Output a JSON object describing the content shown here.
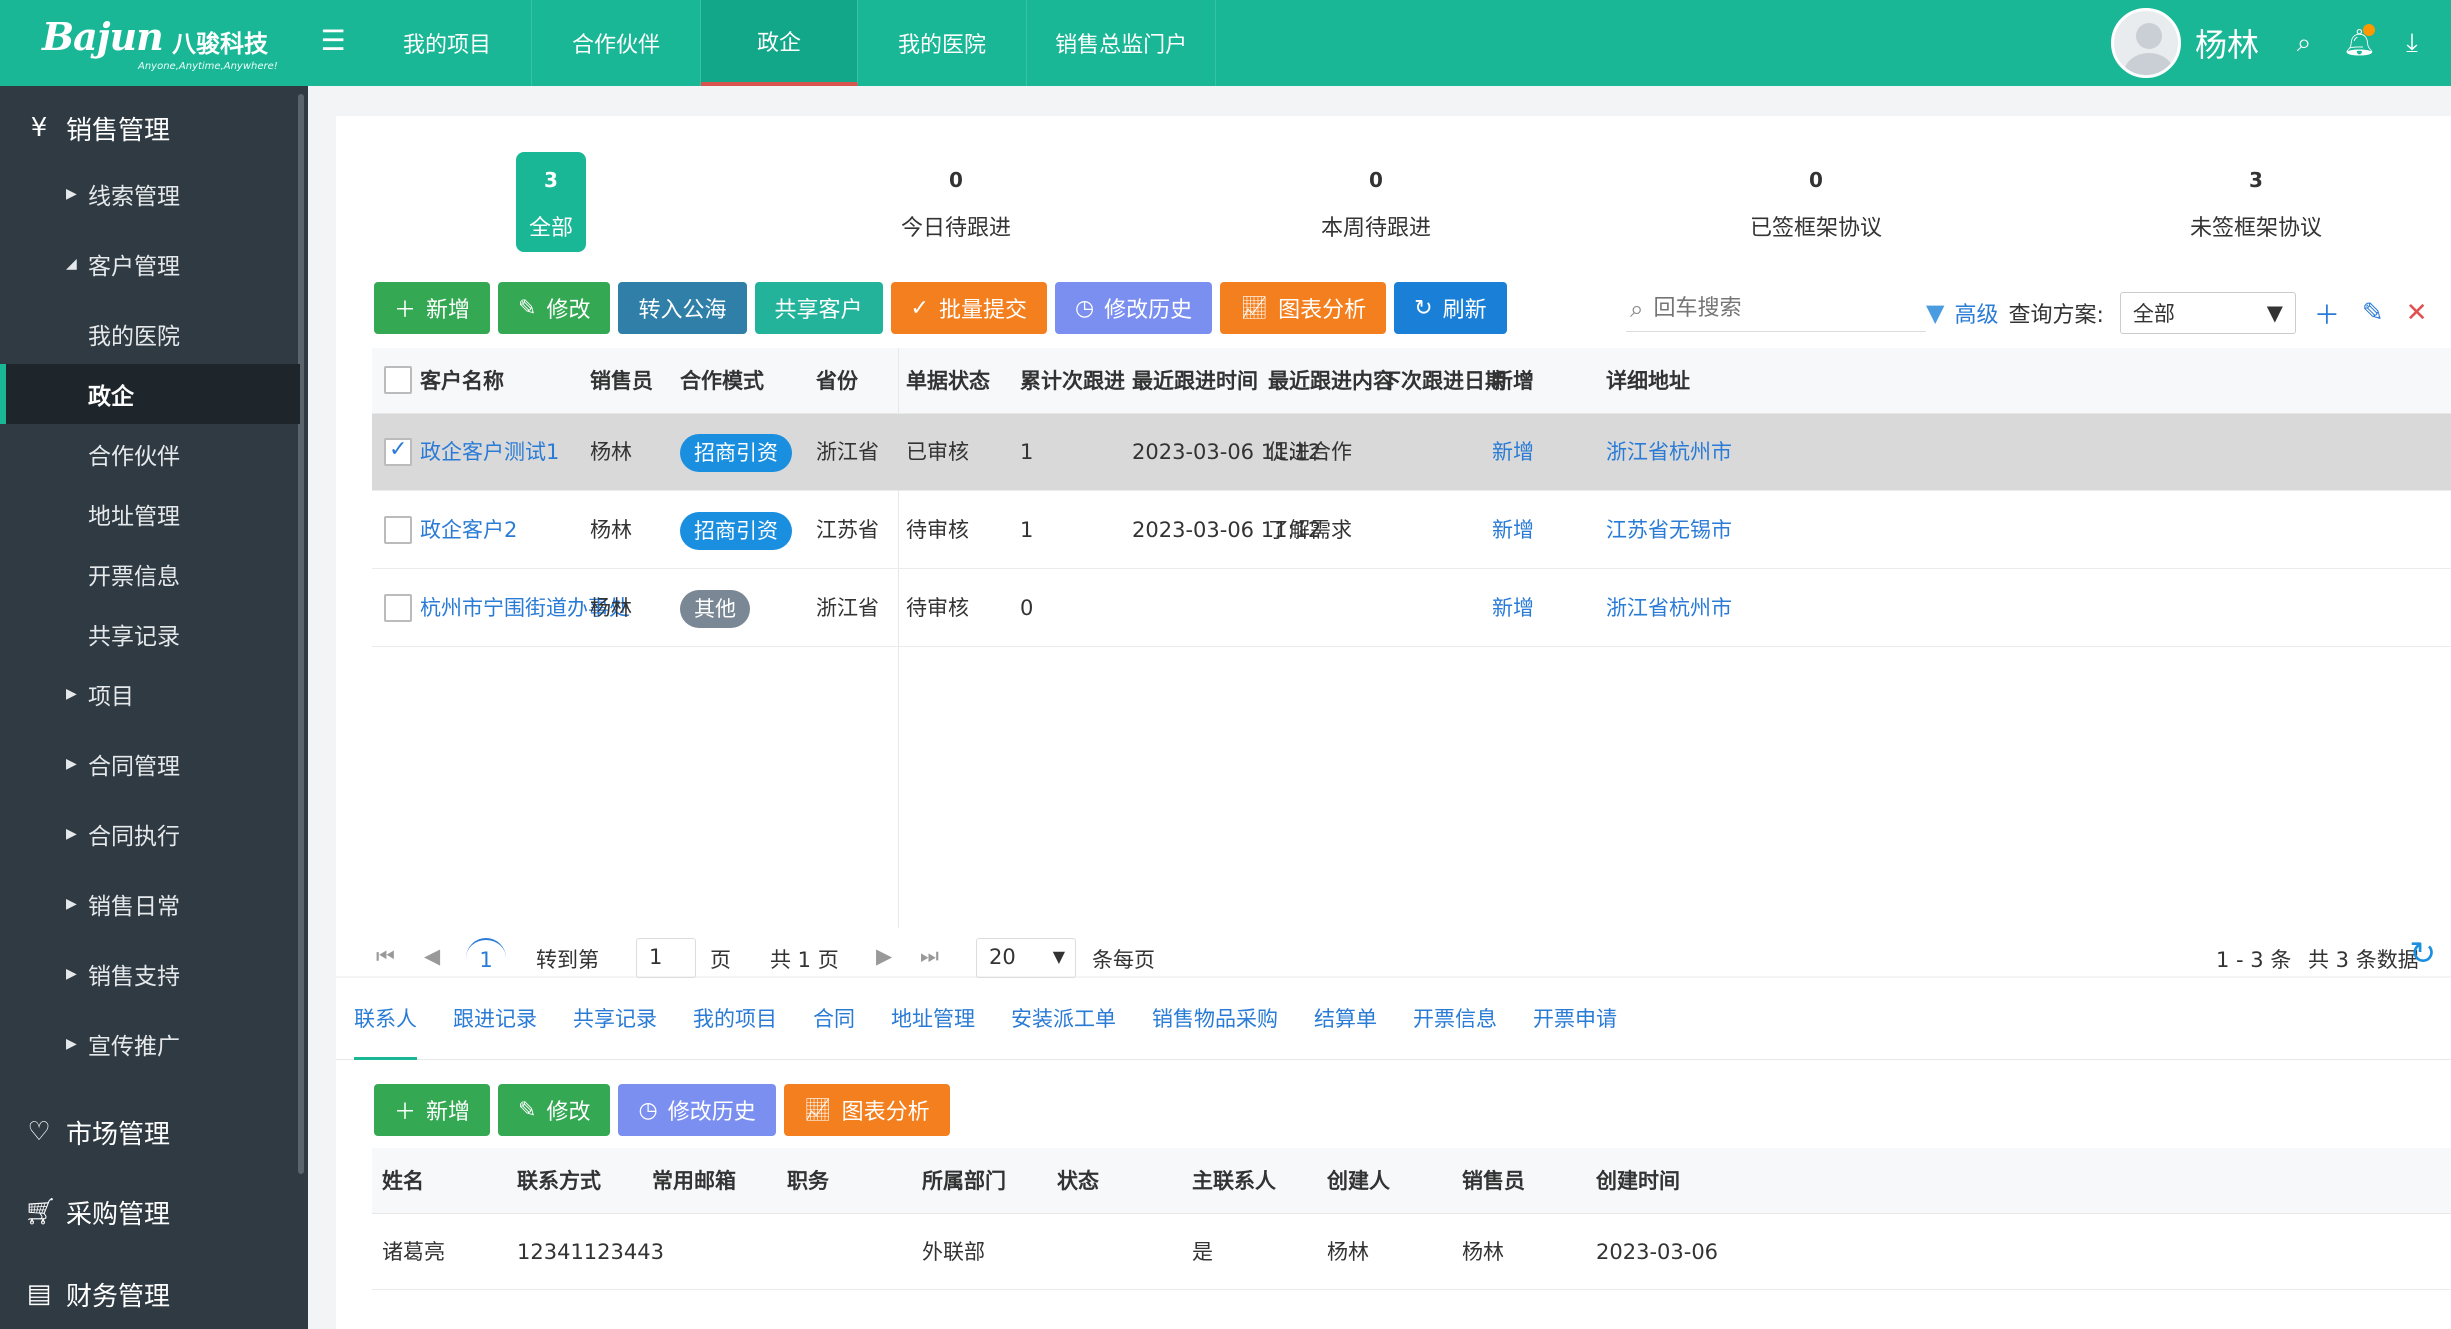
{
  "brand": {
    "name": "Bajun",
    "name_cn": "八骏科技",
    "slogan": "Anyone,Anytime,Anywhere!"
  },
  "topnav": [
    {
      "label": "我的项目",
      "active": false
    },
    {
      "label": "合作伙伴",
      "active": false
    },
    {
      "label": "政企",
      "active": true
    },
    {
      "label": "我的医院",
      "active": false
    },
    {
      "label": "销售总监门户",
      "active": false
    }
  ],
  "user": {
    "name": "杨林"
  },
  "sidebar": {
    "groups": {
      "sales": "销售管理",
      "market": "市场管理",
      "purchase": "采购管理",
      "finance": "财务管理"
    },
    "items": {
      "leads": "线索管理",
      "customers": "客户管理",
      "my_hospital": "我的医院",
      "gov": "政企",
      "partners": "合作伙伴",
      "address": "地址管理",
      "invoice": "开票信息",
      "share": "共享记录",
      "project": "项目",
      "contract": "合同管理",
      "contract_exec": "合同执行",
      "daily": "销售日常",
      "support": "销售支持",
      "promo": "宣传推广"
    }
  },
  "stats": [
    {
      "num": "3",
      "label": "全部",
      "active": true
    },
    {
      "num": "0",
      "label": "今日待跟进",
      "active": false
    },
    {
      "num": "0",
      "label": "本周待跟进",
      "active": false
    },
    {
      "num": "0",
      "label": "已签框架协议",
      "active": false
    },
    {
      "num": "3",
      "label": "未签框架协议",
      "active": false
    }
  ],
  "toolbar": {
    "add": "新增",
    "edit": "修改",
    "to_pool": "转入公海",
    "share": "共享客户",
    "batch_submit": "批量提交",
    "history": "修改历史",
    "chart": "图表分析",
    "refresh": "刷新"
  },
  "search": {
    "placeholder": "回车搜索"
  },
  "query": {
    "advanced": "高级",
    "scheme_label": "查询方案:",
    "scheme_value": "全部"
  },
  "grid": {
    "headers": [
      "客户名称",
      "销售员",
      "合作模式",
      "省份",
      "单据状态",
      "累计次跟进",
      "最近跟进时间",
      "最近跟进内容",
      "下次跟进日期",
      "新增",
      "详细地址"
    ],
    "rows": [
      {
        "name": "政企客户测试1",
        "sales": "杨林",
        "mode": "招商引资",
        "province": "浙江省",
        "status": "已审核",
        "count": "1",
        "last_time": "2023-03-06 11:12",
        "last_content": "促进合作",
        "next_date": "",
        "add": "新增",
        "address": "浙江省杭州市"
      },
      {
        "name": "政企客户2",
        "sales": "杨林",
        "mode": "招商引资",
        "province": "江苏省",
        "status": "待审核",
        "count": "1",
        "last_time": "2023-03-06 11:12",
        "last_content": "了解需求",
        "next_date": "",
        "add": "新增",
        "address": "江苏省无锡市"
      },
      {
        "name": "杭州市宁围街道办事处",
        "sales": "杨林",
        "mode": "其他",
        "province": "浙江省",
        "status": "待审核",
        "count": "0",
        "last_time": "",
        "last_content": "",
        "next_date": "",
        "add": "新增",
        "address": "浙江省杭州市"
      }
    ]
  },
  "pager": {
    "current": "1",
    "goto_label": "转到第",
    "goto_value": "1",
    "page_unit": "页",
    "total_pages": "共 1 页",
    "page_size": "20",
    "per_page": "条每页",
    "range": "1 - 3 条",
    "total": "共 3 条数据"
  },
  "subtabs": [
    "联系人",
    "跟进记录",
    "共享记录",
    "我的项目",
    "合同",
    "地址管理",
    "安装派工单",
    "销售物品采购",
    "结算单",
    "开票信息",
    "开票申请"
  ],
  "toolbar2": {
    "add": "新增",
    "edit": "修改",
    "history": "修改历史",
    "chart": "图表分析"
  },
  "contacts": {
    "headers": [
      "姓名",
      "联系方式",
      "常用邮箱",
      "职务",
      "所属部门",
      "状态",
      "主联系人",
      "创建人",
      "销售员",
      "创建时间"
    ],
    "rows": [
      {
        "name": "诸葛亮",
        "phone": "12341123443",
        "email": "",
        "title": "",
        "dept": "外联部",
        "status": "",
        "primary": "是",
        "creator": "杨林",
        "sales": "杨林",
        "created": "2023-03-06"
      }
    ]
  }
}
